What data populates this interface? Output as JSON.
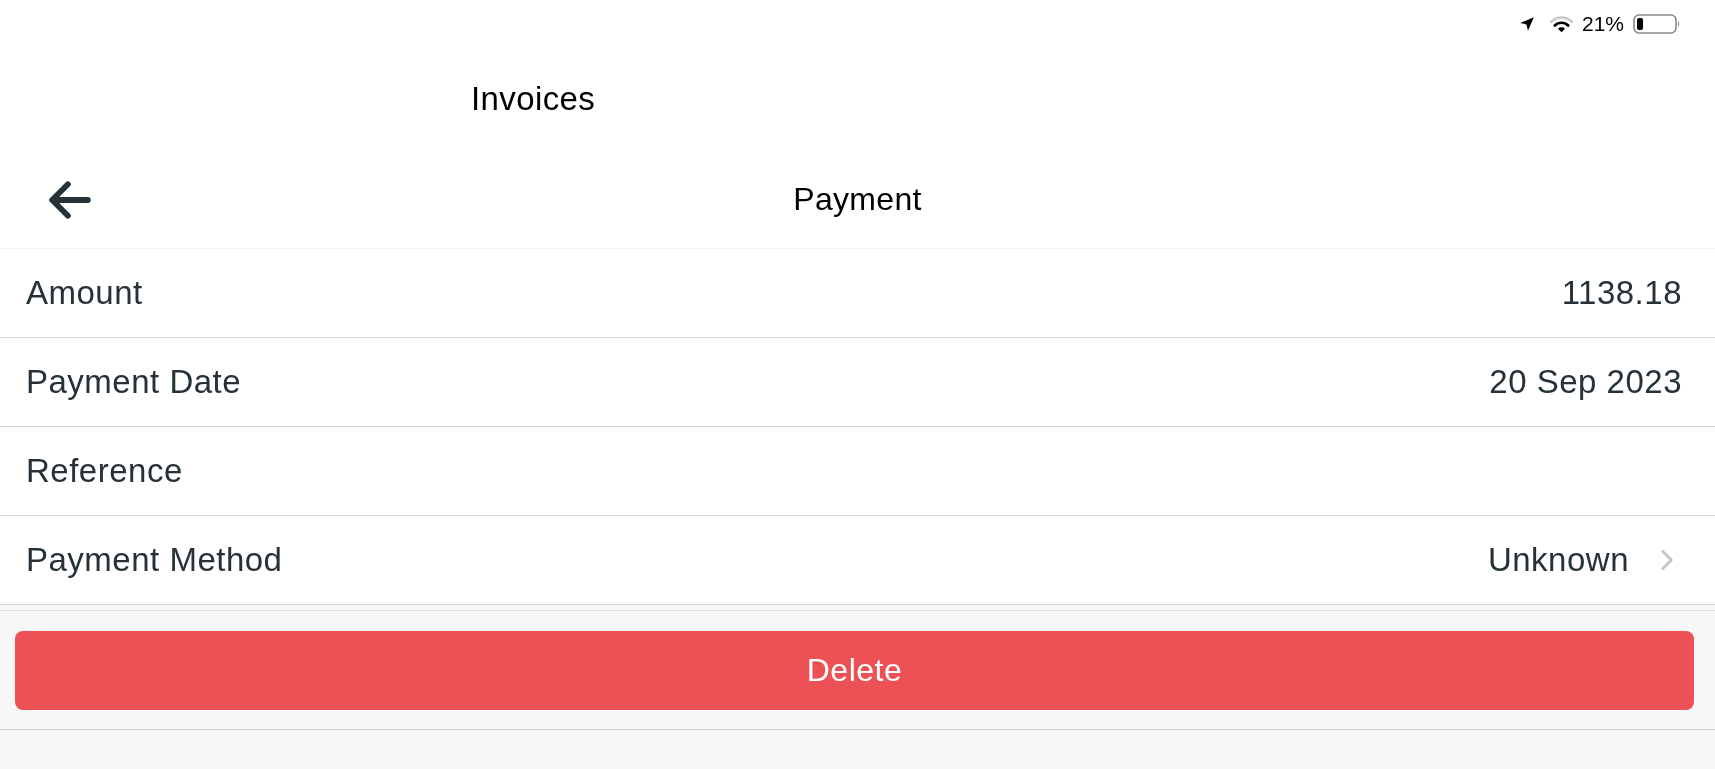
{
  "status_bar": {
    "battery_text": "21%"
  },
  "nav": {
    "title": "Invoices"
  },
  "header": {
    "title": "Payment"
  },
  "rows": [
    {
      "kind": "field",
      "label": "Amount",
      "value": "1138.18"
    },
    {
      "kind": "field",
      "label": "Payment Date",
      "value": "20 Sep 2023"
    },
    {
      "kind": "field",
      "label": "Reference"
    },
    {
      "kind": "picker",
      "label": "Payment Method",
      "value": "Unknown"
    }
  ],
  "delete_button": {
    "label": "Delete"
  }
}
